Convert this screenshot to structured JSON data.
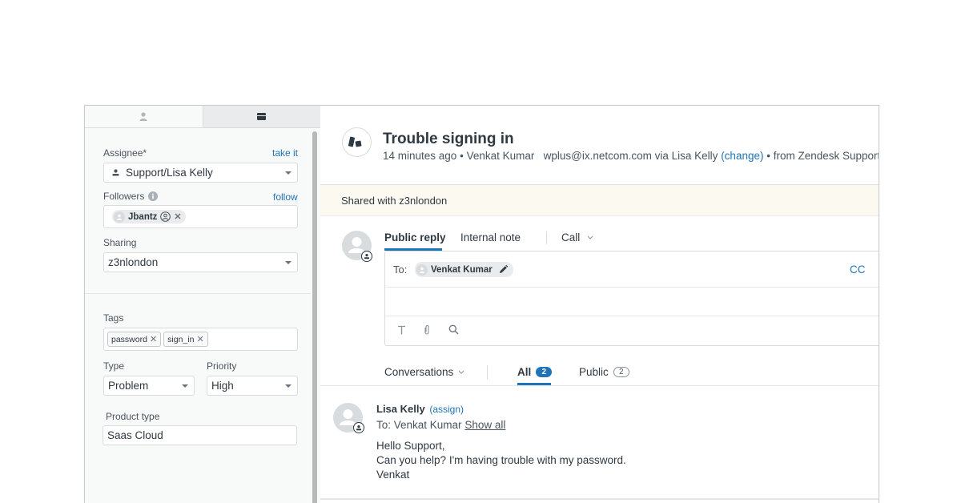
{
  "sidebar": {
    "tabs": [
      {
        "icon": "user-icon",
        "label": "Requester"
      },
      {
        "icon": "card-icon",
        "label": "Ticket"
      }
    ],
    "assignee": {
      "label": "Assignee*",
      "action": "take it",
      "value": "Support/Lisa Kelly"
    },
    "followers": {
      "label": "Followers",
      "action": "follow",
      "items": [
        {
          "name": "Jbantz"
        }
      ]
    },
    "sharing": {
      "label": "Sharing",
      "value": "z3nlondon"
    },
    "tags": {
      "label": "Tags",
      "items": [
        "password",
        "sign_in"
      ]
    },
    "type": {
      "label": "Type",
      "value": "Problem"
    },
    "priority": {
      "label": "Priority",
      "value": "High"
    },
    "product_type": {
      "label": "Product type",
      "value": "Saas Cloud"
    }
  },
  "ticket": {
    "title": "Trouble signing in",
    "time_ago": "14 minutes ago",
    "bullet": "•",
    "requester": "Venkat Kumar",
    "email_via": "wplus@ix.netcom.com via Lisa Kelly",
    "change_label": "(change)",
    "source": "• from Zendesk Support",
    "shared_banner": "Shared with z3nlondon"
  },
  "composer": {
    "tabs": [
      {
        "label": "Public reply",
        "active": true
      },
      {
        "label": "Internal note",
        "active": false
      },
      {
        "label": "Call",
        "active": false
      }
    ],
    "to_label": "To:",
    "recipient": "Venkat Kumar",
    "cc_label": "CC",
    "toolbar": [
      "text-format-icon",
      "attachment-icon",
      "search-icon"
    ]
  },
  "conversation": {
    "filter_label": "Conversations",
    "tabs": [
      {
        "label": "All",
        "count": "2",
        "active": true
      },
      {
        "label": "Public",
        "count": "2",
        "active": false
      }
    ],
    "messages": [
      {
        "author": "Lisa Kelly",
        "assign_label": "(assign)",
        "to": "To: Venkat Kumar",
        "show_all": "Show all",
        "body": [
          "Hello Support,",
          "Can you help? I'm having trouble with my password.",
          "Venkat"
        ]
      }
    ]
  },
  "colors": {
    "accent": "#1f73b7",
    "banner_bg": "#fcfaf0",
    "sidebar_bg": "#f8f9f9"
  }
}
